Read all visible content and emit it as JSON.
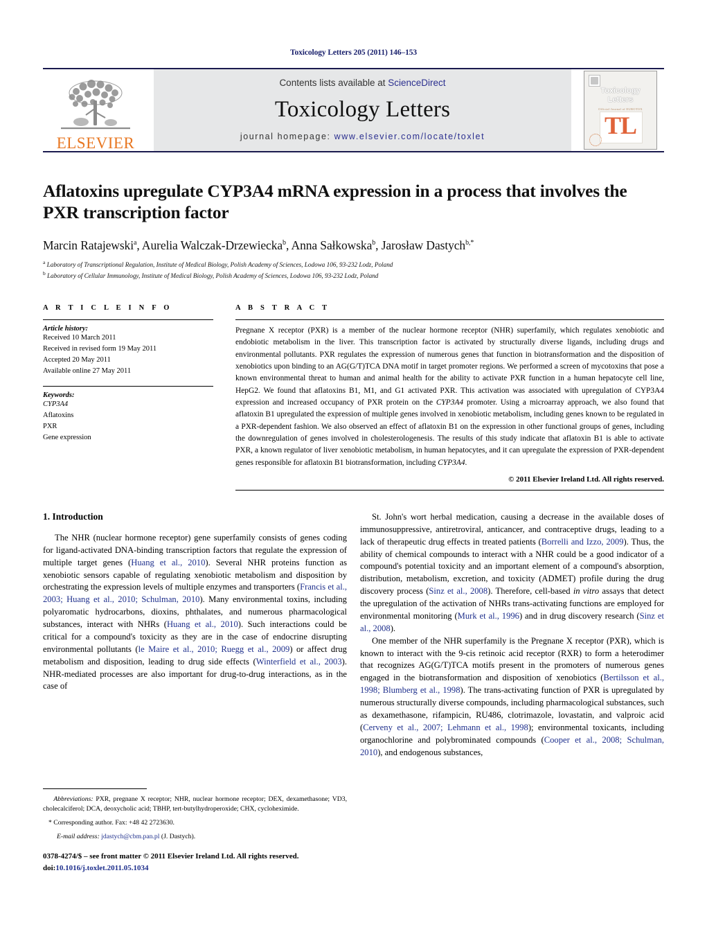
{
  "running_head": "Toxicology Letters 205 (2011) 146–153",
  "masthead": {
    "publisher_logo_label": "ELSEVIER",
    "contents_prefix": "Contents lists available at ",
    "contents_link": "ScienceDirect",
    "journal_title": "Toxicology Letters",
    "homepage_prefix": "journal homepage: ",
    "homepage_url": "www.elsevier.com/locate/toxlet",
    "cover": {
      "title_line1": "Toxicology",
      "title_line2": "Letters",
      "subtitle": "Official Journal of EUROTOX",
      "monogram": "TL"
    }
  },
  "article": {
    "title": "Aflatoxins upregulate CYP3A4 mRNA expression in a process that involves the PXR transcription factor",
    "authors": "Marcin Ratajewski, Aurelia Walczak-Drzewiecka, Anna Sałkowska, Jarosław Dastych",
    "author_list": [
      {
        "name": "Marcin Ratajewski",
        "marks": "a"
      },
      {
        "name": "Aurelia Walczak-Drzewiecka",
        "marks": "b"
      },
      {
        "name": "Anna Sałkowska",
        "marks": "b"
      },
      {
        "name": "Jarosław Dastych",
        "marks": "b,*"
      }
    ],
    "affiliations": [
      {
        "mark": "a",
        "text": "Laboratory of Transcriptional Regulation, Institute of Medical Biology, Polish Academy of Sciences, Lodowa 106, 93-232 Lodz, Poland"
      },
      {
        "mark": "b",
        "text": "Laboratory of Cellular Immunology, Institute of Medical Biology, Polish Academy of Sciences, Lodowa 106, 93-232 Lodz, Poland"
      }
    ]
  },
  "article_info": {
    "heading": "A R T I C L E   I N F O",
    "history_label": "Article history:",
    "history": [
      "Received 10 March 2011",
      "Received in revised form 19 May 2011",
      "Accepted 20 May 2011",
      "Available online 27 May 2011"
    ],
    "keywords_label": "Keywords:",
    "keywords": [
      "CYP3A4",
      "Aflatoxins",
      "PXR",
      "Gene expression"
    ]
  },
  "abstract": {
    "heading": "A B S T R A C T",
    "text_part1": "Pregnane X receptor (PXR) is a member of the nuclear hormone receptor (NHR) superfamily, which regulates xenobiotic and endobiotic metabolism in the liver. This transcription factor is activated by structurally diverse ligands, including drugs and environmental pollutants. PXR regulates the expression of numerous genes that function in biotransformation and the disposition of xenobiotics upon binding to an AG(G/T)TCA DNA motif in target promoter regions. We performed a screen of mycotoxins that pose a known environmental threat to human and animal health for the ability to activate PXR function in a human hepatocyte cell line, HepG2. We found that aflatoxins B1, M1, and G1 activated PXR. This activation was associated with upregulation of CYP3A4 expression and increased occupancy of PXR protein on the ",
    "italic1": "CYP3A4",
    "text_part2": " promoter. Using a microarray approach, we also found that aflatoxin B1 upregulated the expression of multiple genes involved in xenobiotic metabolism, including genes known to be regulated in a PXR-dependent fashion. We also observed an effect of aflatoxin B1 on the expression in other functional groups of genes, including the downregulation of genes involved in cholesterologenesis. The results of this study indicate that aflatoxin B1 is able to activate PXR, a known regulator of liver xenobiotic metabolism, in human hepatocytes, and it can upregulate the expression of PXR-dependent genes responsible for aflatoxin B1 biotransformation, including ",
    "italic2": "CYP3A4",
    "text_part3": ".",
    "copyright": "© 2011 Elsevier Ireland Ltd. All rights reserved."
  },
  "introduction": {
    "section_number_title": "1.  Introduction",
    "left_paragraphs": [
      {
        "segments": [
          {
            "t": "The NHR (nuclear hormone receptor) gene superfamily consists of genes coding for ligand-activated DNA-binding transcription factors that regulate the expression of multiple target genes ("
          },
          {
            "t": "Huang et al., 2010",
            "ref": true
          },
          {
            "t": "). Several NHR proteins function as xenobiotic sensors capable of regulating xenobiotic metabolism and disposition by orchestrating the expression levels of multiple enzymes and transporters ("
          },
          {
            "t": "Francis et al., 2003; Huang et al., 2010; Schulman, 2010",
            "ref": true
          },
          {
            "t": "). Many environmental toxins, including polyaromatic hydrocarbons, dioxins, phthalates, and numerous pharmacological substances, interact with NHRs ("
          },
          {
            "t": "Huang et al., 2010",
            "ref": true
          },
          {
            "t": "). Such interactions could be critical for a compound's toxicity as they are in the case of endocrine disrupting environmental pollutants ("
          },
          {
            "t": "le Maire et al., 2010; Ruegg et al., 2009",
            "ref": true
          },
          {
            "t": ") or affect drug metabolism and disposition, leading to drug side effects ("
          },
          {
            "t": "Winterfield et al., 2003",
            "ref": true
          },
          {
            "t": "). NHR-mediated processes are also important for drug-to-drug interactions, as in the case of"
          }
        ]
      }
    ],
    "right_paragraphs": [
      {
        "continuation": true,
        "segments": [
          {
            "t": "St. John's wort herbal medication, causing a decrease in the available doses of immunosuppressive, antiretroviral, anticancer, and contraceptive drugs, leading to a lack of therapeutic drug effects in treated patients ("
          },
          {
            "t": "Borrelli and Izzo, 2009",
            "ref": true
          },
          {
            "t": "). Thus, the ability of chemical compounds to interact with a NHR could be a good indicator of a compound's potential toxicity and an important element of a compound's absorption, distribution, metabolism, excretion, and toxicity (ADMET) profile during the drug discovery process ("
          },
          {
            "t": "Sinz et al., 2008",
            "ref": true
          },
          {
            "t": "). Therefore, cell-based "
          },
          {
            "t": "in vitro",
            "italic": true
          },
          {
            "t": " assays that detect the upregulation of the activation of NHRs trans-activating functions are employed for environmental monitoring ("
          },
          {
            "t": "Murk et al., 1996",
            "ref": true
          },
          {
            "t": ") and in drug discovery research ("
          },
          {
            "t": "Sinz et al., 2008",
            "ref": true
          },
          {
            "t": ")."
          }
        ]
      },
      {
        "continuation": false,
        "segments": [
          {
            "t": "One member of the NHR superfamily is the Pregnane X receptor (PXR), which is known to interact with the 9-cis retinoic acid receptor (RXR) to form a heterodimer that recognizes AG(G/T)TCA motifs present in the promoters of numerous genes engaged in the biotransformation and disposition of xenobiotics ("
          },
          {
            "t": "Bertilsson et al., 1998; Blumberg et al., 1998",
            "ref": true
          },
          {
            "t": "). The trans-activating function of PXR is upregulated by numerous structurally diverse compounds, including pharmacological substances, such as dexamethasone, rifampicin, RU486, clotrimazole, lovastatin, and valproic acid ("
          },
          {
            "t": "Cerveny et al., 2007; Lehmann et al., 1998",
            "ref": true
          },
          {
            "t": "); environmental toxicants, including organochlorine and polybrominated compounds ("
          },
          {
            "t": "Cooper et al., 2008; Schulman, 2010",
            "ref": true
          },
          {
            "t": "), and endogenous substances,"
          }
        ]
      }
    ]
  },
  "footnotes": {
    "abbreviations_label": "Abbreviations:",
    "abbreviations_text": "  PXR, pregnane X receptor; NHR, nuclear hormone receptor; DEX, dexamethasone; VD3, cholecalciferol; DCA, deoxycholic acid; TBHP, tert-butylhydroperoxide; CHX, cycloheximide.",
    "corresponding_mark": "*",
    "corresponding_text": "Corresponding author. Fax: +48 42 2723630.",
    "email_label": "E-mail address:",
    "email": "jdastych@cbm.pan.pl",
    "email_suffix": "(J. Dastych)."
  },
  "footer": {
    "issn_line": "0378-4274/$ – see front matter © 2011 Elsevier Ireland Ltd. All rights reserved.",
    "doi_label": "doi:",
    "doi": "10.1016/j.toxlet.2011.05.1034"
  }
}
